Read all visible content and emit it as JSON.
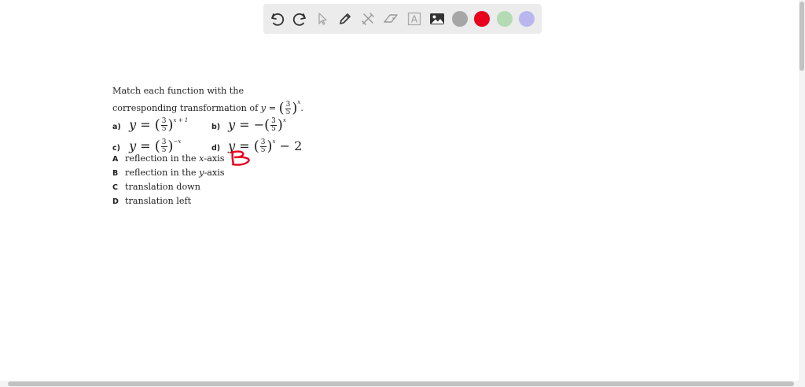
{
  "toolbar": {
    "tools": [
      {
        "name": "undo-icon"
      },
      {
        "name": "redo-icon"
      },
      {
        "name": "pointer-icon"
      },
      {
        "name": "pencil-icon"
      },
      {
        "name": "tools-icon"
      },
      {
        "name": "eraser-icon"
      },
      {
        "name": "text-icon",
        "glyph": "A"
      },
      {
        "name": "image-icon"
      }
    ],
    "colors": [
      "#a6a6a6",
      "#e8001c",
      "#b4dbb4",
      "#b9b7ee"
    ]
  },
  "question": {
    "line1": "Match each function with the",
    "line2_prefix": "corresponding transformation of",
    "y": "y",
    "eq": "=",
    "num": "3",
    "den": "5",
    "x": "x",
    "period": ".",
    "parts": {
      "a": {
        "label": "a)",
        "exp": "x + 1",
        "prefix": "",
        "suffix": ""
      },
      "b": {
        "label": "b)",
        "exp": "x",
        "prefix": "−",
        "suffix": ""
      },
      "c": {
        "label": "c)",
        "exp": "−x",
        "prefix": "",
        "suffix": ""
      },
      "d": {
        "label": "d)",
        "exp": "x",
        "prefix": "",
        "suffix": "− 2"
      }
    },
    "choices": [
      {
        "letter": "A",
        "before": "reflection in the ",
        "var": "x",
        "after": "-axis"
      },
      {
        "letter": "B",
        "before": "reflection in the ",
        "var": "y",
        "after": "-axis"
      },
      {
        "letter": "C",
        "before": "translation down",
        "var": "",
        "after": ""
      },
      {
        "letter": "D",
        "before": "translation left",
        "var": "",
        "after": ""
      }
    ]
  },
  "annotation": {
    "text": "B",
    "color": "#e8001c"
  }
}
